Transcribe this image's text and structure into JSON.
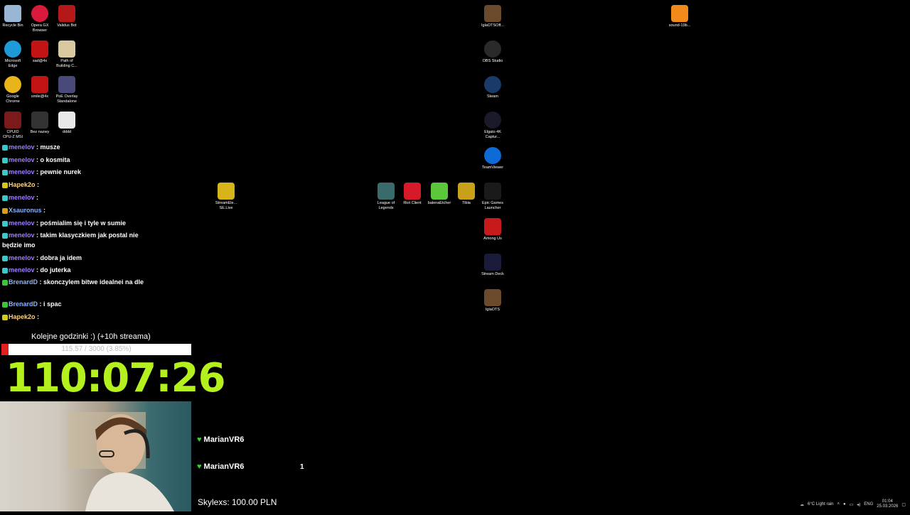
{
  "desktop_icons": [
    {
      "label": "Recycle Bin",
      "name": "recycle-bin-icon",
      "color": "#9ab6d6"
    },
    {
      "label": "Opera GX\nBrowser",
      "name": "opera-gx-icon",
      "color": "#d91a3c"
    },
    {
      "label": "Validus Bot",
      "name": "validus-bot-icon",
      "color": "#b41818"
    },
    {
      "label": "Microsoft\nEdge",
      "name": "edge-icon",
      "color": "#1e9ad6"
    },
    {
      "label": "sad@4x",
      "name": "sad-icon",
      "color": "#c21414"
    },
    {
      "label": "Path of\nBuilding C...",
      "name": "path-of-building-icon",
      "color": "#d9c8a0"
    },
    {
      "label": "Google\nChrome",
      "name": "chrome-icon",
      "color": "#e8b41a"
    },
    {
      "label": "smile@4x",
      "name": "smile-icon",
      "color": "#c21414"
    },
    {
      "label": "PoE Overlay\nStandalone",
      "name": "poe-overlay-icon",
      "color": "#4a4a7a"
    },
    {
      "label": "CPUID\nCPU-Z MSI",
      "name": "cpuz-icon",
      "color": "#7a1a1a"
    },
    {
      "label": "Bez nazwy",
      "name": "bez-nazwy-icon",
      "color": "#333"
    },
    {
      "label": "dddd",
      "name": "dddd-icon",
      "color": "#e8e8e8"
    },
    {
      "label": "IglaOTSOff...",
      "name": "iglaots-off-icon",
      "color": "#6a4a2a"
    },
    {
      "label": "sound-19b...",
      "name": "vlc-icon",
      "color": "#f08a1a"
    },
    {
      "label": "OBS Studio",
      "name": "obs-icon",
      "color": "#2a2a2a"
    },
    {
      "label": "Steam",
      "name": "steam-icon",
      "color": "#1a3a6a"
    },
    {
      "label": "Elgato 4K\nCaptur...",
      "name": "elgato-icon",
      "color": "#1a1a2a"
    },
    {
      "label": "TeamViewer",
      "name": "teamviewer-icon",
      "color": "#0e6ad6"
    },
    {
      "label": "StreamEle...\nSE.Live",
      "name": "streamelements-icon",
      "color": "#d6b41a"
    },
    {
      "label": "League of\nLegends",
      "name": "league-icon",
      "color": "#3a6a6a"
    },
    {
      "label": "Riot Client",
      "name": "riot-client-icon",
      "color": "#d61a2a"
    },
    {
      "label": "balenaEtcher",
      "name": "balena-icon",
      "color": "#5ac83a"
    },
    {
      "label": "Tibia",
      "name": "tibia-icon",
      "color": "#c8a01a"
    },
    {
      "label": "Epic Games\nLauncher",
      "name": "epic-games-icon",
      "color": "#1a1a1a"
    },
    {
      "label": "Among Us",
      "name": "among-us-icon",
      "color": "#c81a1a"
    },
    {
      "label": "Stream Deck",
      "name": "stream-deck-icon",
      "color": "#1a1a3a"
    },
    {
      "label": "IglaOTS",
      "name": "iglaots-icon",
      "color": "#6a4a2a"
    }
  ],
  "chat": [
    {
      "user": "menelov",
      "msg": "musze"
    },
    {
      "user": "menelov",
      "msg": "o kosmita"
    },
    {
      "user": "menelov",
      "msg": "pewnie nurek"
    },
    {
      "user": "Hapek2o",
      "msg": ""
    },
    {
      "user": "menelov",
      "msg": ""
    },
    {
      "user": "Xsauronus",
      "msg": ""
    },
    {
      "user": "menelov",
      "msg": "pośmialim się i tyle w sumie"
    },
    {
      "user": "menelov",
      "msg": "takim klasyczkiem jak postal nie będzie imo"
    },
    {
      "user": "menelov",
      "msg": "dobra ja idem"
    },
    {
      "user": "menelov",
      "msg": "do juterka"
    },
    {
      "user": "BrenardD",
      "msg": "skonczylem bitwe idealnei na dle"
    },
    {
      "user": "BrenardD",
      "msg": "i spac"
    },
    {
      "user": "Hapek2o",
      "msg": ""
    }
  ],
  "goal": {
    "title": "Kolejne godzinki :) (+10h streama)",
    "progress_text": "115.57 / 3000 (3.85%)",
    "percent": 3.85
  },
  "timer": "110:07:26",
  "alerts": {
    "follower1": "MarianVR6",
    "follower2": "MarianVR6",
    "count": "1",
    "donation": "Skylexs: 100.00 PLN"
  },
  "tray": {
    "weather": "6°C  Light rain",
    "lang": "ENG",
    "time": "01:04",
    "date": "25.03.2026"
  }
}
